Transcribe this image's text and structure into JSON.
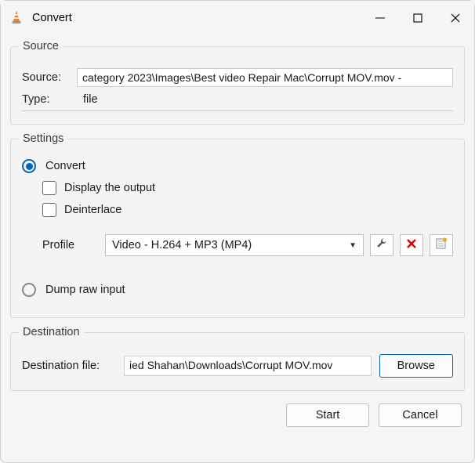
{
  "window": {
    "title": "Convert"
  },
  "source": {
    "legend": "Source",
    "source_label": "Source:",
    "source_value": "- category 2023\\Images\\Best video Repair Mac\\Corrupt MOV.mov",
    "type_label": "Type:",
    "type_value": "file"
  },
  "settings": {
    "legend": "Settings",
    "convert_label": "Convert",
    "display_output_label": "Display the output",
    "deinterlace_label": "Deinterlace",
    "profile_label": "Profile",
    "profile_selected": "Video - H.264 + MP3 (MP4)",
    "dump_label": "Dump raw input"
  },
  "destination": {
    "legend": "Destination",
    "dest_label": "Destination file:",
    "dest_value": "ied Shahan\\Downloads\\Corrupt MOV.mov",
    "browse_label": "Browse"
  },
  "footer": {
    "start_label": "Start",
    "cancel_label": "Cancel"
  }
}
